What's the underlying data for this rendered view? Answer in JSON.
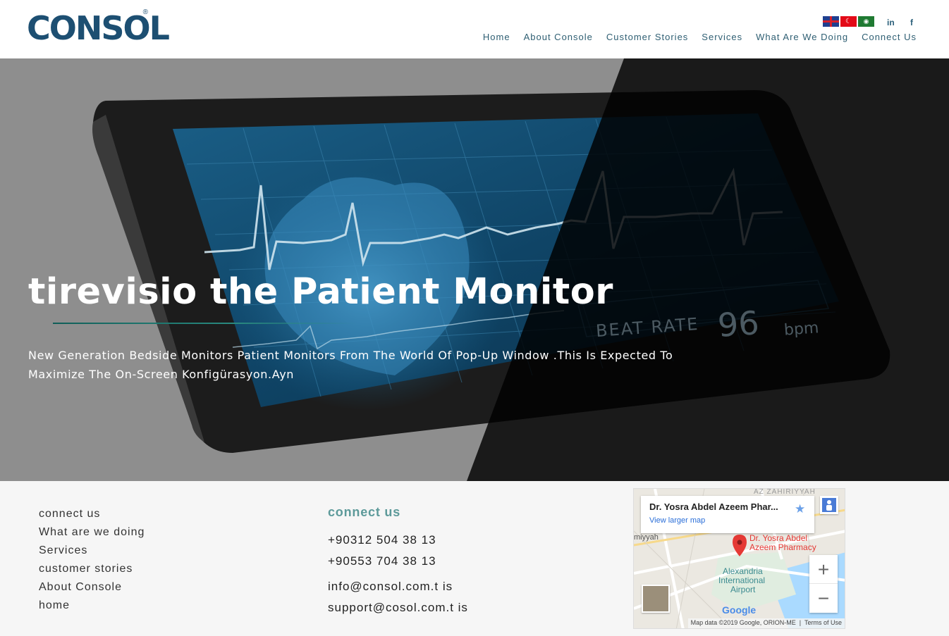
{
  "brand": {
    "logo_text": "CONSOL",
    "registered": "®"
  },
  "header": {
    "languages": [
      "en-flag",
      "tr-flag",
      "ar-flag"
    ],
    "social": {
      "linkedin": "in",
      "facebook": "f"
    },
    "nav": [
      "Home",
      "About Console",
      "Customer Stories",
      "Services",
      "What Are We Doing",
      "Connect Us"
    ]
  },
  "hero": {
    "title": "tirevisio the Patient Monitor",
    "description": "New Generation Bedside Monitors Patient Monitors From The World Of Pop-Up Window .This Is Expected To Maximize The On-Screen Konfigürasyon.Ayn",
    "screen_readout": {
      "label": "BEAT RATE",
      "value": "96",
      "unit": "bpm"
    }
  },
  "footer": {
    "links": [
      "connect us",
      "What are we doing",
      "Services",
      "customer stories",
      "About Console",
      "home"
    ],
    "contact": {
      "title": "connect us",
      "phones": [
        "+90312 504 38 13",
        "+90553 704 38 13"
      ],
      "emails": [
        "info@consol.com.t is",
        "support@cosol.com.t is"
      ]
    },
    "map": {
      "place_title": "Dr. Yosra Abdel Azeem Phar...",
      "view_larger": "View larger map",
      "pin_label_line1": "Dr. Yosra Abdel",
      "pin_label_line2": "Azeem Pharmacy",
      "airport_line1": "Alexandria",
      "airport_line2": "International",
      "airport_line3": "Airport",
      "area_top": "AZ ZAHIRIYYAH",
      "area_left": "miyyah",
      "google": "Google",
      "attribution": "Map data ©2019 Google, ORION-ME",
      "terms": "Terms of Use"
    }
  },
  "colors": {
    "nav": "#2f5f73",
    "accent": "#5d9a9a",
    "logo": "#1d4f72"
  }
}
